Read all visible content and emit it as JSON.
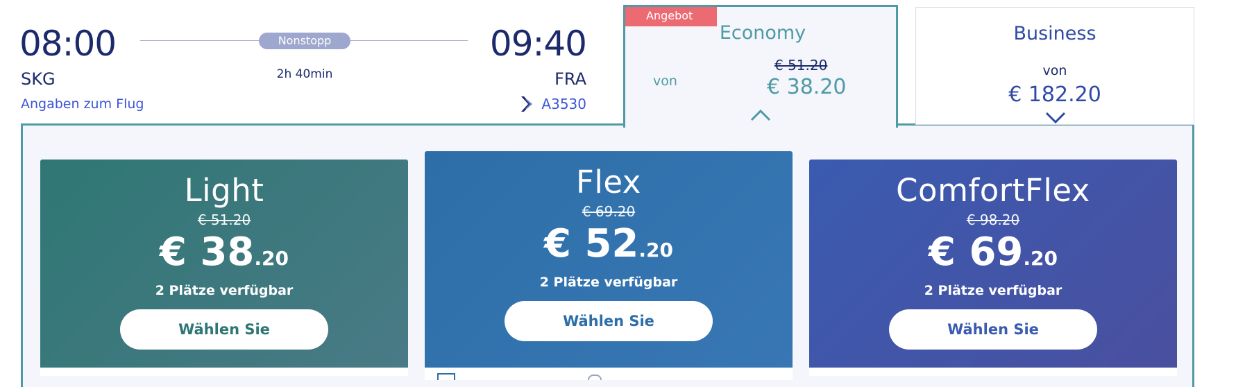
{
  "flight": {
    "departure_time": "08:00",
    "arrival_time": "09:40",
    "departure_code": "SKG",
    "arrival_code": "FRA",
    "stops_badge": "Nonstopp",
    "duration": "2h 40min",
    "details_link": "Angaben zum Flug",
    "flight_number": "A3530"
  },
  "cabins": {
    "economy": {
      "offer_ribbon": "Angebot",
      "title": "Economy",
      "from_label": "von",
      "old_price": "€ 51.20",
      "price": "€ 38.20"
    },
    "business": {
      "title": "Business",
      "from_label": "von",
      "price": "€ 182.20"
    }
  },
  "fares": [
    {
      "name": "Light",
      "old_price": "€ 51.20",
      "price_main": "€ 38",
      "price_cents": ".20",
      "seats": "2 Plätze verfügbar",
      "button": "Wählen Sie"
    },
    {
      "name": "Flex",
      "old_price": "€ 69.20",
      "price_main": "€ 52",
      "price_cents": ".20",
      "seats": "2 Plätze verfügbar",
      "button": "Wählen Sie"
    },
    {
      "name": "ComfortFlex",
      "old_price": "€ 98.20",
      "price_main": "€ 69",
      "price_cents": ".20",
      "seats": "2 Plätze verfügbar",
      "button": "Wählen Sie"
    }
  ],
  "colors": {
    "navy": "#1c2a6b",
    "teal_accent": "#4e9aa5",
    "offer_red": "#ec6b72",
    "link_blue": "#3b54d6"
  },
  "icons": {
    "airline": "aegean-airlines-logo-icon",
    "expand_up": "chevron-up-icon",
    "expand_down": "chevron-down-icon"
  }
}
